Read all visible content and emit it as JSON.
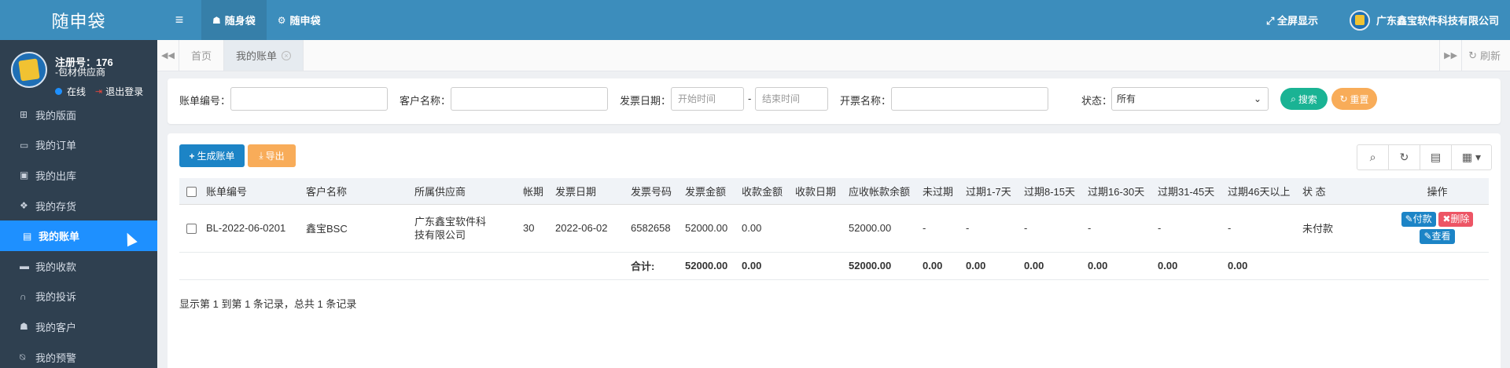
{
  "app": {
    "title": "随申袋"
  },
  "profile": {
    "reg_no": "注册号：176",
    "role": "-包材供应商",
    "status": "在线",
    "logout": "退出登录"
  },
  "sidebar": {
    "items": [
      {
        "label": "我的版面",
        "icon": "layout-icon"
      },
      {
        "label": "我的订单",
        "icon": "monitor-icon"
      },
      {
        "label": "我的出库",
        "icon": "bus-icon"
      },
      {
        "label": "我的存货",
        "icon": "cubes-icon"
      },
      {
        "label": "我的账单",
        "icon": "bill-icon"
      },
      {
        "label": "我的收款",
        "icon": "card-icon"
      },
      {
        "label": "我的投诉",
        "icon": "headset-icon"
      },
      {
        "label": "我的客户",
        "icon": "users-icon"
      },
      {
        "label": "我的预警",
        "icon": "bell-slash-icon"
      }
    ],
    "active_index": 4
  },
  "topbar": {
    "nav": [
      {
        "label": "随身袋",
        "icon": "users-icon"
      },
      {
        "label": "随申袋",
        "icon": "gear-icon"
      }
    ],
    "fullscreen": "全屏显示",
    "company": "广东鑫宝软件科技有限公司"
  },
  "tabs": {
    "items": [
      "首页",
      "我的账单"
    ],
    "refresh": "刷新"
  },
  "search": {
    "bill_no_label": "账单编号：",
    "customer_label": "客户名称：",
    "invoice_date_label": "发票日期：",
    "start_placeholder": "开始时间",
    "range_sep": "-",
    "end_placeholder": "结束时间",
    "invoice_name_label": "开票名称：",
    "status_label": "状态：",
    "status_value": "所有",
    "search_btn": "搜索",
    "reset_btn": "重置"
  },
  "toolbar": {
    "create": "生成账单",
    "export": "导出"
  },
  "table": {
    "headers": [
      "账单编号",
      "客户名称",
      "所属供应商",
      "帐期",
      "发票日期",
      "发票号码",
      "发票金额",
      "收款金额",
      "收款日期",
      "应收帐款余额",
      "未过期",
      "过期1-7天",
      "过期8-15天",
      "过期16-30天",
      "过期31-45天",
      "过期46天以上",
      "状 态",
      "操作"
    ],
    "rows": [
      {
        "bill_no": "BL-2022-06-0201",
        "customer": "鑫宝BSC",
        "supplier": "广东鑫宝软件科技有限公司",
        "period": "30",
        "invoice_date": "2022-06-02",
        "invoice_no": "6582658",
        "invoice_amount": "52000.00",
        "received_amount": "0.00",
        "received_date": "",
        "balance": "52000.00",
        "not_due": "-",
        "d1_7": "-",
        "d8_15": "-",
        "d16_30": "-",
        "d31_45": "-",
        "d46_plus": "-",
        "status": "未付款"
      }
    ],
    "totals": {
      "label": "合计:",
      "invoice_amount": "52000.00",
      "received_amount": "0.00",
      "balance": "52000.00",
      "not_due": "0.00",
      "d1_7": "0.00",
      "d8_15": "0.00",
      "d16_30": "0.00",
      "d31_45": "0.00",
      "d46_plus": "0.00"
    },
    "ops": {
      "pay": "付款",
      "delete": "删除",
      "view": "查看"
    }
  },
  "footer": {
    "summary": "显示第 1 到第 1 条记录，总共 1 条记录"
  }
}
